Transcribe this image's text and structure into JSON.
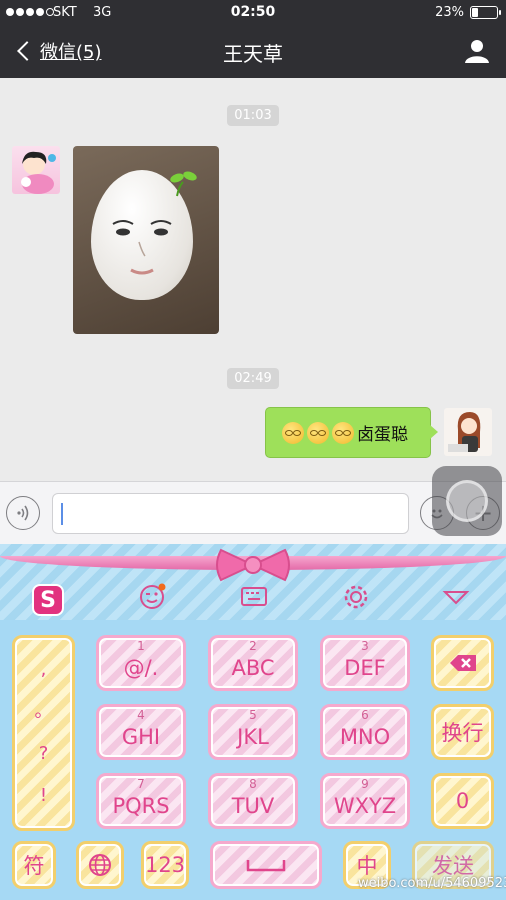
{
  "status_bar": {
    "carrier": "SKT",
    "network": "3G",
    "time": "02:50",
    "battery_percent": "23%",
    "battery_level": 0.23
  },
  "nav": {
    "back_label": "微信(5)",
    "title": "王天草"
  },
  "chat": {
    "timestamp_1": "01:03",
    "timestamp_2": "02:49",
    "sent_message": "卤蛋聪"
  },
  "keyboard": {
    "punctuation": [
      ",",
      "。",
      "?",
      "!"
    ],
    "keys": [
      {
        "num": "1",
        "label": "@/."
      },
      {
        "num": "2",
        "label": "ABC"
      },
      {
        "num": "3",
        "label": "DEF"
      },
      {
        "num": "4",
        "label": "GHI"
      },
      {
        "num": "5",
        "label": "JKL"
      },
      {
        "num": "6",
        "label": "MNO"
      },
      {
        "num": "7",
        "label": "PQRS"
      },
      {
        "num": "8",
        "label": "TUV"
      },
      {
        "num": "9",
        "label": "WXYZ"
      }
    ],
    "enter_label": "换行",
    "zero_label": "0",
    "symbol_label": "符",
    "num_label": "123",
    "lang_label": "中",
    "send_label": "发送"
  },
  "watermark": "weibo.com/u/5460952383"
}
